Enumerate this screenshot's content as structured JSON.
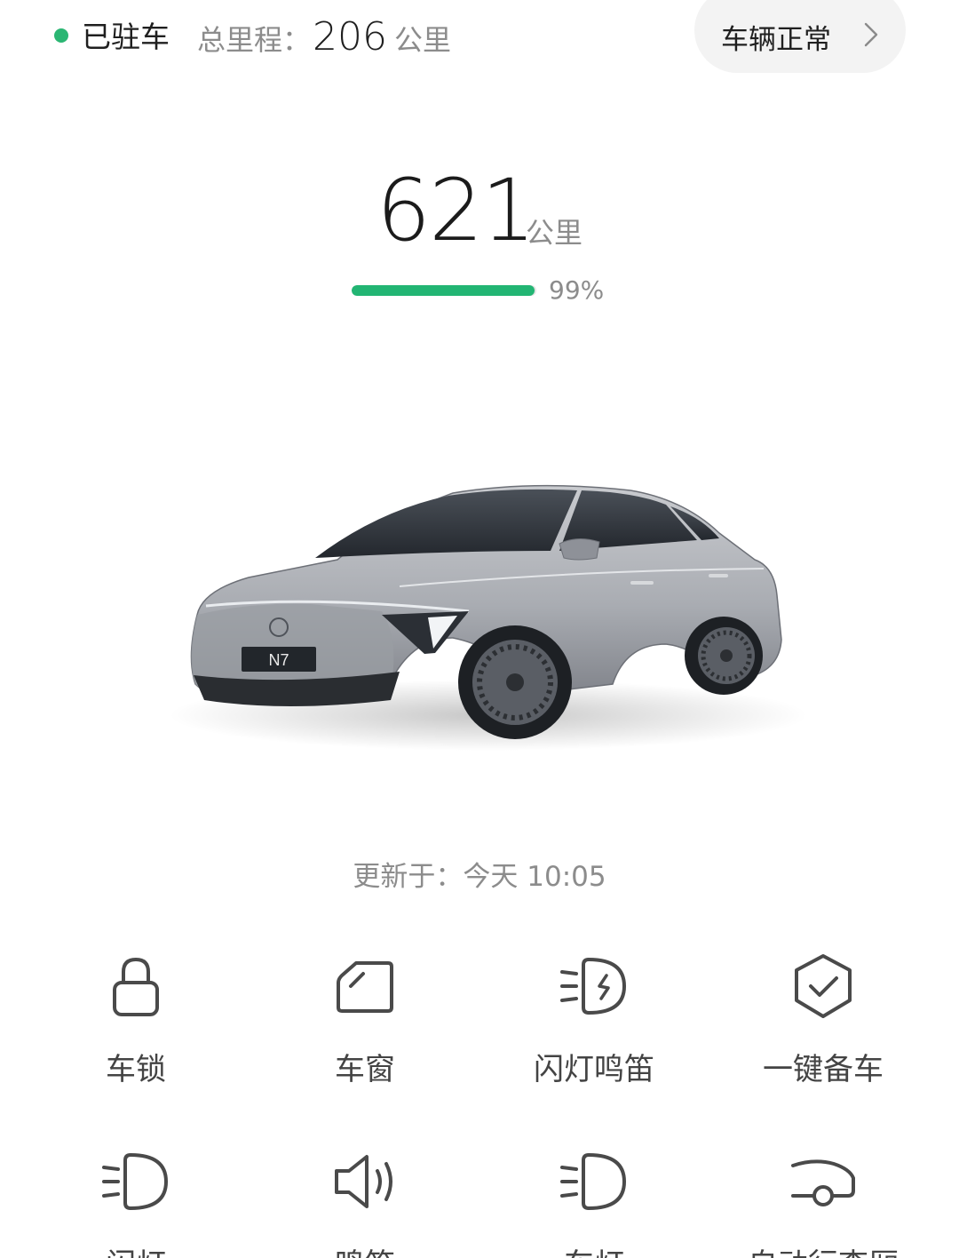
{
  "status": {
    "parked_label": "已驻车",
    "mileage_label": "总里程：",
    "mileage_value": "206",
    "mileage_unit": "公里",
    "health_label": "车辆正常",
    "indicator_color": "#2bb673"
  },
  "range": {
    "value": "621",
    "unit": "公里",
    "battery_percent_text": "99%",
    "battery_percent": 99,
    "bar_color": "#22b573"
  },
  "car": {
    "plate_text": "N7"
  },
  "updated_text": "更新于：今天 10:05",
  "controls": [
    {
      "label": "车锁",
      "icon": "lock-icon"
    },
    {
      "label": "车窗",
      "icon": "window-icon"
    },
    {
      "label": "闪灯鸣笛",
      "icon": "flash-horn-icon"
    },
    {
      "label": "一键备车",
      "icon": "shield-check-icon"
    },
    {
      "label": "闪灯",
      "icon": "headlight-icon"
    },
    {
      "label": "鸣笛",
      "icon": "speaker-icon"
    },
    {
      "label": "车灯",
      "icon": "headlight-icon"
    },
    {
      "label": "自动行李厢",
      "icon": "trunk-icon"
    }
  ]
}
